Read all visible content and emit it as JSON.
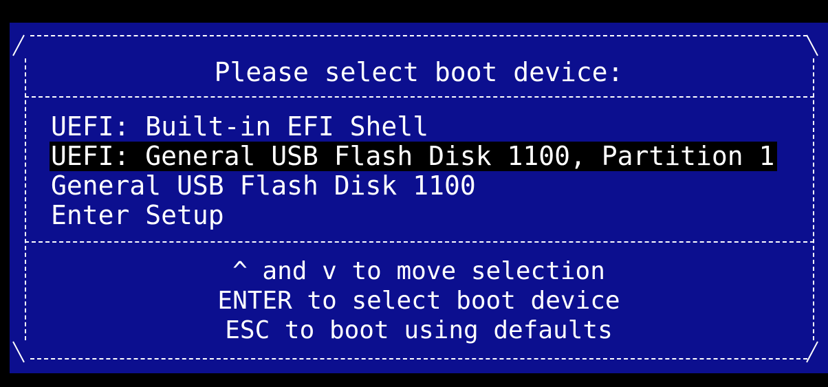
{
  "title": "Please select boot device:",
  "menu": {
    "items": [
      {
        "label": "UEFI: Built-in EFI Shell"
      },
      {
        "label": "UEFI: General USB Flash Disk 1100, Partition 1"
      },
      {
        "label": "General USB Flash Disk 1100"
      },
      {
        "label": "Enter Setup"
      }
    ],
    "selected_index": 1
  },
  "help": {
    "line1": "^ and v to move selection",
    "line2": "ENTER to select boot device",
    "line3": "ESC to boot using defaults"
  },
  "colors": {
    "background": "#000000",
    "panel": "#0c0f8f",
    "text": "#ffffff",
    "highlight": "#000000"
  }
}
